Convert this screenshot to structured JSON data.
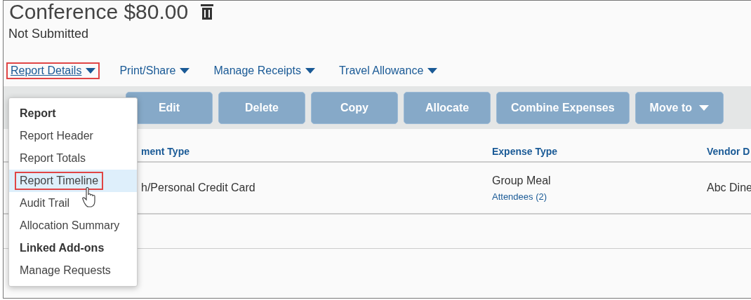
{
  "header": {
    "title": "Conference $80.00",
    "status": "Not Submitted"
  },
  "tabs": [
    {
      "label": "Report Details",
      "highlighted": true
    },
    {
      "label": "Print/Share",
      "highlighted": false
    },
    {
      "label": "Manage Receipts",
      "highlighted": false
    },
    {
      "label": "Travel Allowance",
      "highlighted": false
    }
  ],
  "toolbar": [
    {
      "label": "Edit",
      "disabled": true,
      "dropdown": false
    },
    {
      "label": "Delete",
      "disabled": true,
      "dropdown": false
    },
    {
      "label": "Copy",
      "disabled": true,
      "dropdown": false
    },
    {
      "label": "Allocate",
      "disabled": true,
      "dropdown": false
    },
    {
      "label": "Combine Expenses",
      "disabled": true,
      "dropdown": false
    },
    {
      "label": "Move to",
      "disabled": true,
      "dropdown": true
    }
  ],
  "table": {
    "columns": [
      "ment Type",
      "Expense Type",
      "Vendor D"
    ],
    "rows": [
      {
        "column_1": "h/Personal Credit Card",
        "expense_type": "Group Meal",
        "attendees": "Attendees (2)",
        "vendor": "Abc Dine"
      }
    ]
  },
  "menu": {
    "items": [
      {
        "kind": "heading",
        "label": "Report"
      },
      {
        "kind": "item",
        "label": "Report Header",
        "selected": false
      },
      {
        "kind": "item",
        "label": "Report Totals",
        "selected": false
      },
      {
        "kind": "item",
        "label": "Report Timeline",
        "selected": true
      },
      {
        "kind": "item",
        "label": "Audit Trail",
        "selected": false
      },
      {
        "kind": "item",
        "label": "Allocation Summary",
        "selected": false
      },
      {
        "kind": "heading",
        "label": "Linked Add-ons"
      },
      {
        "kind": "item",
        "label": "Manage Requests",
        "selected": false
      }
    ]
  }
}
